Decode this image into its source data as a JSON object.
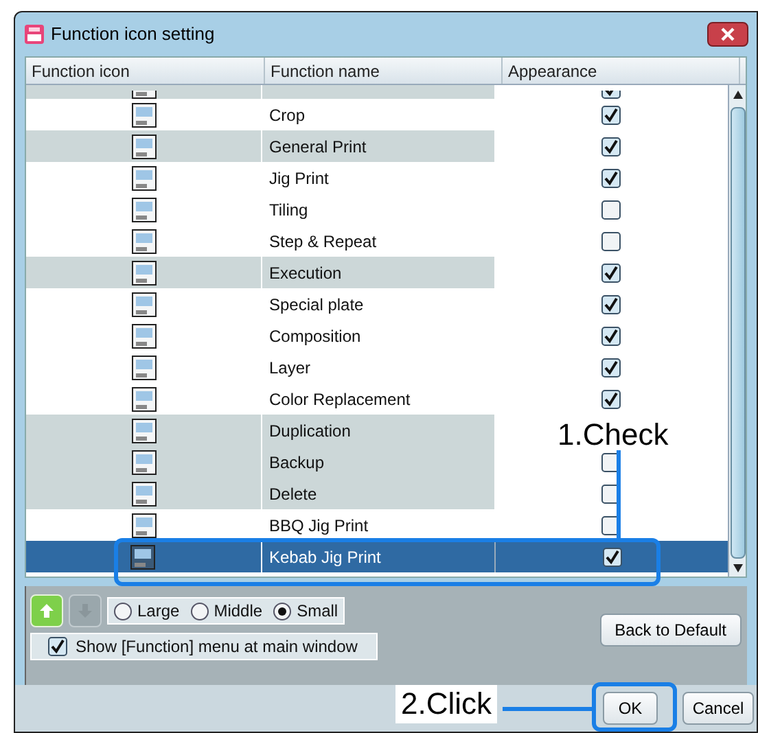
{
  "window": {
    "title": "Function icon setting"
  },
  "table": {
    "columns": [
      "Function icon",
      "Function name",
      "Appearance"
    ],
    "rows": [
      {
        "kind": "partial",
        "shaded": true,
        "checked": true,
        "selected": false
      },
      {
        "kind": "full",
        "name": "Crop",
        "shaded": false,
        "checked": true,
        "selected": false
      },
      {
        "kind": "full",
        "name": "General Print",
        "shaded": true,
        "checked": true,
        "selected": false
      },
      {
        "kind": "full",
        "name": "Jig Print",
        "shaded": false,
        "checked": true,
        "selected": false
      },
      {
        "kind": "full",
        "name": "Tiling",
        "shaded": false,
        "checked": false,
        "selected": false
      },
      {
        "kind": "full",
        "name": "Step & Repeat",
        "shaded": false,
        "checked": false,
        "selected": false
      },
      {
        "kind": "full",
        "name": "Execution",
        "shaded": true,
        "checked": true,
        "selected": false
      },
      {
        "kind": "full",
        "name": "Special plate",
        "shaded": false,
        "checked": true,
        "selected": false
      },
      {
        "kind": "full",
        "name": "Composition",
        "shaded": false,
        "checked": true,
        "selected": false
      },
      {
        "kind": "full",
        "name": "Layer",
        "shaded": false,
        "checked": true,
        "selected": false
      },
      {
        "kind": "full",
        "name": "Color Replacement",
        "shaded": false,
        "checked": true,
        "selected": false
      },
      {
        "kind": "full",
        "name": "Duplication",
        "shaded": true,
        "selected": false
      },
      {
        "kind": "full",
        "name": "Backup",
        "shaded": true,
        "checked": false,
        "selected": false
      },
      {
        "kind": "full",
        "name": "Delete",
        "shaded": true,
        "checked": false,
        "selected": false
      },
      {
        "kind": "full",
        "name": "BBQ Jig Print",
        "shaded": false,
        "checked": false,
        "selected": false
      },
      {
        "kind": "full",
        "name": "Kebab Jig Print",
        "shaded": false,
        "checked": true,
        "selected": true
      }
    ]
  },
  "order_buttons": [
    {
      "kind": "up",
      "disabled": false
    },
    {
      "kind": "down",
      "disabled": true
    }
  ],
  "icon_size": [
    {
      "label": "Large",
      "selected": false
    },
    {
      "label": "Middle",
      "selected": false
    },
    {
      "label": "Small",
      "selected": true
    }
  ],
  "show_menu": {
    "label": "Show [Function] menu at main window",
    "checked": true
  },
  "buttons": {
    "back_to_default": "Back to Default",
    "ok": "OK",
    "cancel": "Cancel"
  },
  "annotations": [
    {
      "kind": "check",
      "text": "1.Check"
    },
    {
      "kind": "click",
      "text": "2.Click"
    }
  ]
}
